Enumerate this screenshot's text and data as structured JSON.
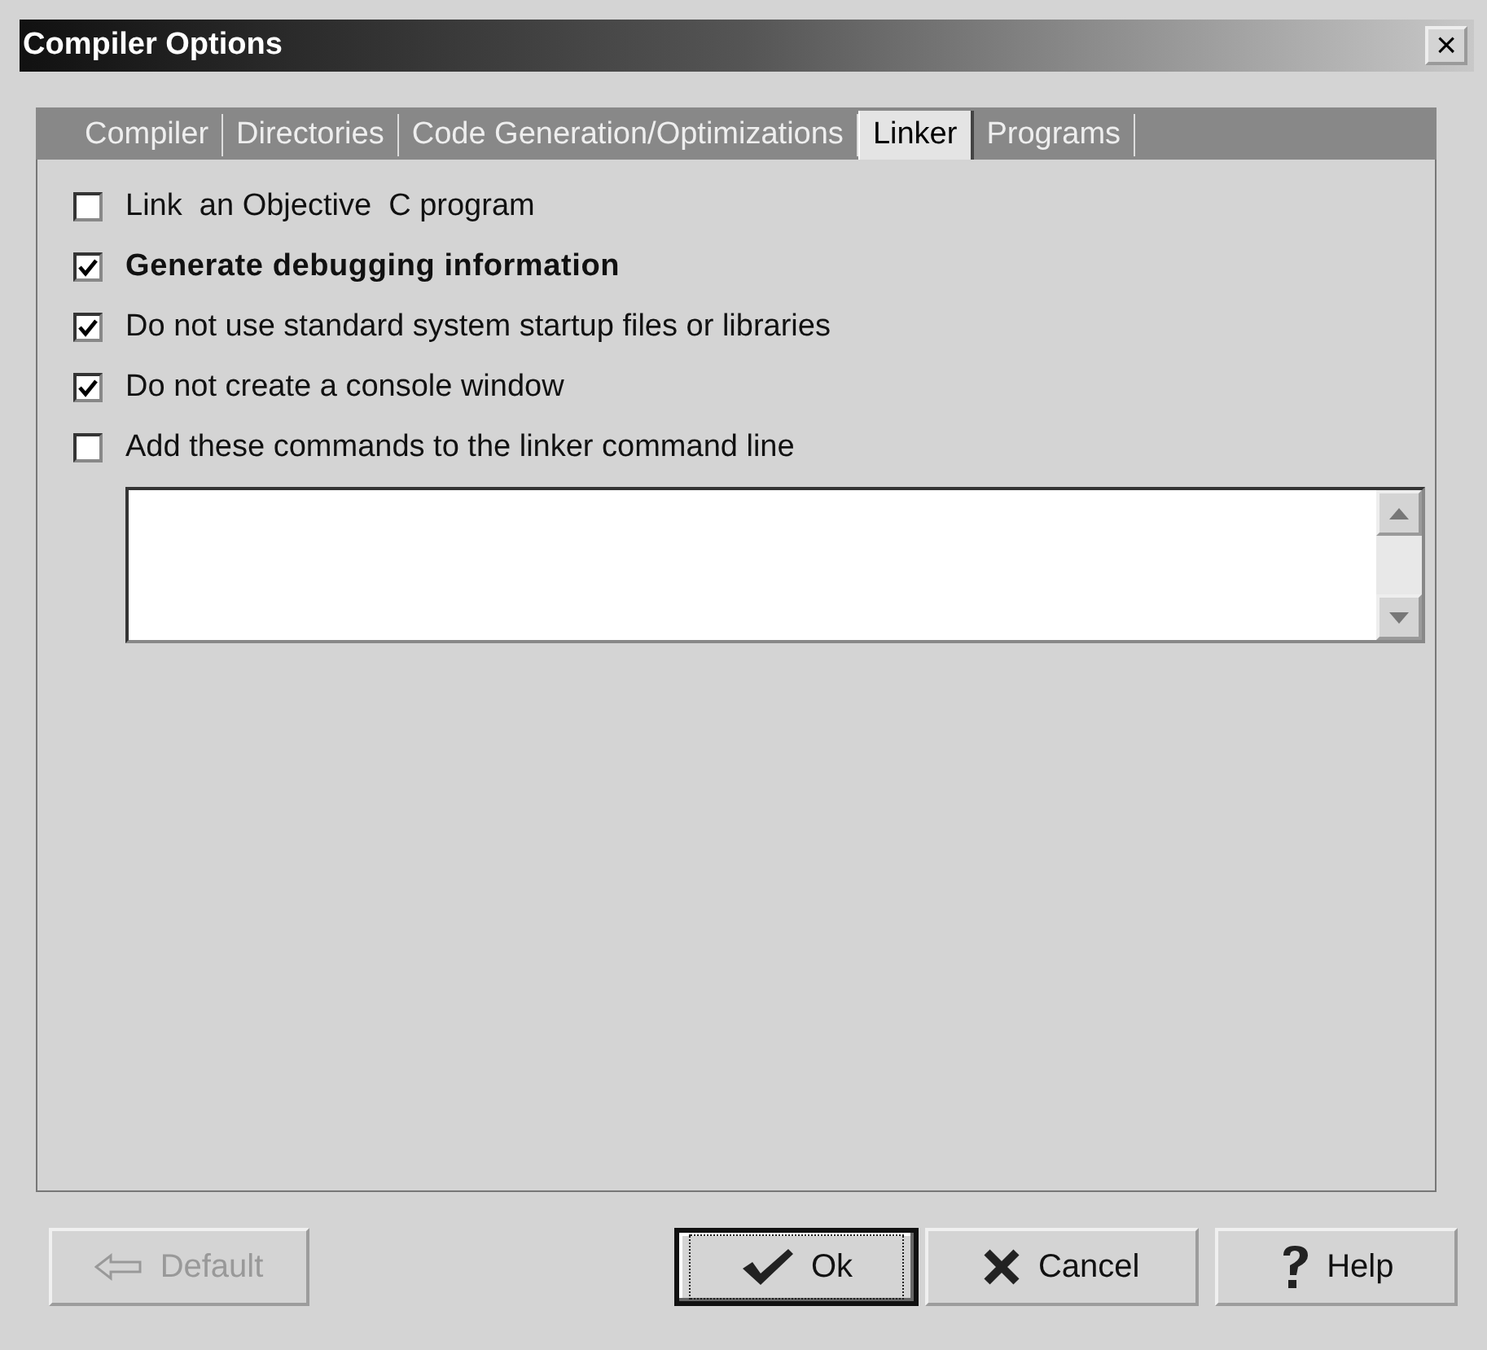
{
  "window": {
    "title": "Compiler Options",
    "close": "×"
  },
  "tabs": [
    {
      "label": "Compiler",
      "selected": false
    },
    {
      "label": "Directories",
      "selected": false
    },
    {
      "label": "Code Generation/Optimizations",
      "selected": false
    },
    {
      "label": "Linker",
      "selected": true
    },
    {
      "label": "Programs",
      "selected": false
    }
  ],
  "options": [
    {
      "label": "Link  an Objective  C program",
      "checked": false,
      "bold": false
    },
    {
      "label": "Generate debugging information",
      "checked": true,
      "bold": true
    },
    {
      "label": "Do not use standard system startup files or libraries",
      "checked": true,
      "bold": false
    },
    {
      "label": "Do not create a console window",
      "checked": true,
      "bold": false
    },
    {
      "label": "Add these commands to the linker command line",
      "checked": false,
      "bold": false
    }
  ],
  "buttons": [
    {
      "kind": "default",
      "label": "Default",
      "disabled": true,
      "focused": false
    },
    {
      "kind": "ok",
      "label": "Ok",
      "disabled": false,
      "focused": true
    },
    {
      "kind": "cancel",
      "label": "Cancel",
      "disabled": false,
      "focused": false
    },
    {
      "kind": "help",
      "label": "Help",
      "disabled": false,
      "focused": false
    }
  ]
}
